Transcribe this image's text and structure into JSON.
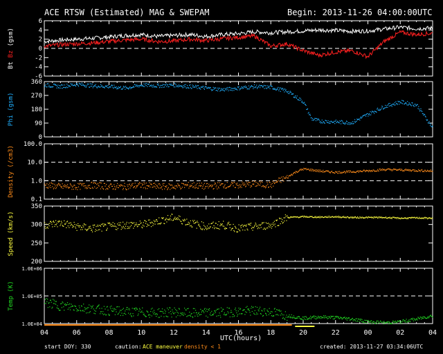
{
  "header": {
    "title": "ACE RTSW (Estimated) MAG & SWEPAM",
    "begin": "Begin: 2013-11-26 04:00:00UTC"
  },
  "footer": {
    "start_doy": "start DOY: 330",
    "caution_label": "caution:",
    "caution_ace": "ACE maneuver",
    "caution_density": "density < 1",
    "created": "created: 2013-11-27 03:34:06UTC",
    "xlabel": "UTC(hours)"
  },
  "colors": {
    "bt": "#ffffff",
    "bz": "#ff2020",
    "phi": "#20b0ff",
    "density": "#ff8c1a",
    "speed": "#ffff40",
    "temp": "#22dd22",
    "axis": "#ffffff",
    "caution_ace": "#ffff40",
    "caution_density": "#ff8c1a"
  },
  "chart_data": [
    {
      "type": "line",
      "panel": "mag",
      "ylabel_parts": [
        "Bt",
        "Bz",
        "(gsm)"
      ],
      "ylim": [
        -6,
        6
      ],
      "yticks": [
        -6,
        -4,
        -2,
        0,
        2,
        4,
        6
      ],
      "yticklabels": [
        "-6",
        "-4",
        "-2",
        "0",
        "2",
        "4",
        "6"
      ],
      "dashed_lines": [
        0
      ],
      "series": [
        {
          "name": "Bt",
          "color_key": "bt",
          "x": [
            0,
            1,
            2,
            3,
            4,
            5,
            6,
            7,
            8,
            9,
            10,
            11,
            12,
            13,
            14,
            15,
            16,
            17,
            18,
            19,
            20,
            21,
            22,
            23,
            24
          ],
          "y": [
            1.5,
            1.8,
            2.0,
            2.2,
            2.5,
            2.8,
            3.0,
            2.6,
            2.8,
            3.0,
            2.6,
            3.0,
            3.2,
            3.6,
            3.4,
            3.6,
            3.8,
            4.0,
            3.9,
            3.7,
            3.8,
            4.2,
            4.6,
            4.3,
            4.4
          ]
        },
        {
          "name": "Bz",
          "color_key": "bz",
          "x": [
            0,
            1,
            2,
            3,
            4,
            5,
            6,
            7,
            8,
            9,
            10,
            11,
            12,
            13,
            14,
            15,
            16,
            17,
            18,
            19,
            20,
            21,
            22,
            23,
            24
          ],
          "y": [
            0.5,
            0.8,
            1.0,
            1.2,
            1.5,
            1.8,
            2.0,
            1.5,
            1.6,
            2.0,
            1.7,
            2.1,
            2.4,
            2.7,
            0.5,
            1.0,
            -0.5,
            -1.5,
            -0.8,
            -0.5,
            -1.8,
            1.5,
            3.5,
            3.0,
            3.3
          ]
        }
      ]
    },
    {
      "type": "scatter",
      "panel": "phi",
      "ylabel": "Phi (gsm)",
      "ylim": [
        0,
        360
      ],
      "yticks": [
        0,
        90,
        180,
        270,
        360
      ],
      "yticklabels": [
        "0",
        "90",
        "180",
        "270",
        "360"
      ],
      "series": [
        {
          "name": "Phi",
          "color_key": "phi",
          "x": [
            0,
            1,
            2,
            3,
            4,
            5,
            6,
            7,
            8,
            9,
            10,
            11,
            12,
            13,
            14,
            15,
            16,
            16.5,
            17,
            18,
            19,
            20,
            21,
            22,
            23,
            24
          ],
          "y": [
            340,
            330,
            345,
            335,
            330,
            320,
            340,
            335,
            340,
            330,
            320,
            310,
            320,
            330,
            325,
            300,
            230,
            120,
            105,
            100,
            95,
            150,
            200,
            230,
            210,
            60
          ]
        }
      ]
    },
    {
      "type": "scatter",
      "panel": "density",
      "ylabel": "Density (/cm3)",
      "log_scale": true,
      "ylim": [
        0.1,
        100
      ],
      "yticks": [
        0.1,
        1,
        10,
        100
      ],
      "yticklabels": [
        "0.1",
        "1.0",
        "10.0",
        "100.0"
      ],
      "dashed_lines": [
        1,
        10
      ],
      "series": [
        {
          "name": "Density",
          "color_key": "density",
          "x": [
            0,
            1,
            2,
            3,
            4,
            5,
            6,
            7,
            8,
            9,
            10,
            11,
            12,
            13,
            14,
            15,
            16,
            17,
            18,
            19,
            20,
            21,
            22,
            23,
            24
          ],
          "y": [
            0.6,
            0.5,
            0.5,
            0.6,
            0.5,
            0.5,
            0.6,
            0.5,
            0.5,
            0.6,
            0.5,
            0.6,
            0.6,
            0.7,
            0.6,
            1.5,
            4.5,
            3.5,
            3.0,
            3.2,
            3.6,
            4.2,
            4.0,
            3.8,
            3.5
          ]
        }
      ]
    },
    {
      "type": "scatter",
      "panel": "speed",
      "ylabel": "Speed (km/s)",
      "ylim": [
        200,
        350
      ],
      "yticks": [
        200,
        250,
        300,
        350
      ],
      "yticklabels": [
        "200",
        "250",
        "300",
        "350"
      ],
      "series": [
        {
          "name": "Speed",
          "color_key": "speed",
          "x": [
            0,
            1,
            2,
            3,
            4,
            5,
            6,
            7,
            8,
            9,
            10,
            11,
            12,
            13,
            14,
            15,
            16,
            17,
            18,
            19,
            20,
            21,
            22,
            23,
            24
          ],
          "y": [
            300,
            305,
            295,
            290,
            295,
            300,
            300,
            310,
            320,
            305,
            295,
            300,
            290,
            295,
            300,
            320,
            322,
            321,
            322,
            320,
            320,
            320,
            318,
            319,
            318
          ]
        }
      ]
    },
    {
      "type": "scatter",
      "panel": "temp",
      "ylabel": "Temp (K)",
      "log_scale": true,
      "ylim": [
        10000,
        1000000
      ],
      "yticks": [
        10000,
        100000,
        1000000
      ],
      "yticklabels": [
        "1.0E+04",
        "1.0E+05",
        "1.0E+06"
      ],
      "dashed_lines": [
        100000
      ],
      "series": [
        {
          "name": "Temp",
          "color_key": "temp",
          "x": [
            0,
            1,
            2,
            3,
            4,
            5,
            6,
            7,
            8,
            9,
            10,
            11,
            12,
            13,
            14,
            15,
            16,
            17,
            18,
            19,
            20,
            21,
            22,
            23,
            24
          ],
          "y": [
            60000,
            45000,
            40000,
            35000,
            30000,
            28000,
            26000,
            25000,
            27000,
            24000,
            25000,
            26000,
            28000,
            30000,
            27000,
            20000,
            16000,
            18000,
            17000,
            15000,
            12000,
            11000,
            12000,
            15000,
            20000
          ]
        }
      ]
    }
  ],
  "x_axis": {
    "ticks": [
      0,
      2,
      4,
      6,
      8,
      10,
      12,
      14,
      16,
      18,
      20,
      22,
      24
    ],
    "ticklabels": [
      "04",
      "06",
      "08",
      "10",
      "12",
      "14",
      "16",
      "18",
      "20",
      "22",
      "00",
      "02",
      "04"
    ]
  }
}
